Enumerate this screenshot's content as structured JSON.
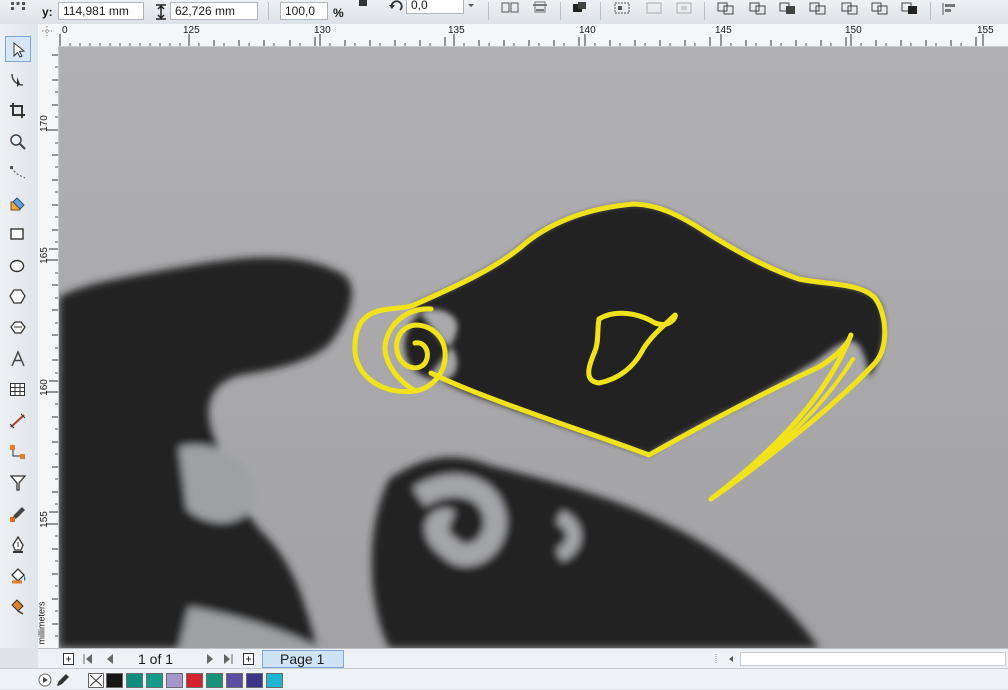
{
  "property_bar": {
    "y_label": "y:",
    "y_value": "114,981 mm",
    "height_value": "62,726 mm",
    "scale_value": "100,0",
    "scale_unit": "%",
    "rotation_value": "0,0"
  },
  "toolbox": {
    "tools": [
      "pick-tool-icon",
      "shape-tool-icon",
      "crop-tool-icon",
      "zoom-tool-icon",
      "freehand-tool-icon",
      "smart-fill-tool-icon",
      "rectangle-tool-icon",
      "ellipse-tool-icon",
      "polygon-tool-icon",
      "basic-shapes-tool-icon",
      "text-tool-icon",
      "table-tool-icon",
      "dimension-tool-icon",
      "connector-tool-icon",
      "blend-tool-icon",
      "eyedropper-tool-icon",
      "outline-tool-icon",
      "fill-tool-icon",
      "interactive-fill-tool-icon"
    ],
    "active_tool": "pick-tool-icon"
  },
  "rulers": {
    "horizontal_labels": [
      "0",
      "125",
      "130",
      "135",
      "140",
      "145",
      "150",
      "155"
    ],
    "vertical_labels": [
      "170",
      "165",
      "160",
      "155"
    ],
    "unit": "millimeters"
  },
  "page_navigator": {
    "page_count_text": "1 of 1",
    "page_tab": "Page 1"
  },
  "palette": {
    "colors": [
      "#151515",
      "#0f8c7e",
      "#159a8e",
      "#a796cc",
      "#d6222e",
      "#18937a",
      "#5b4da1",
      "#3b3688",
      "#1fb4d2"
    ]
  },
  "drawing": {
    "outline_color": "#f2e21a",
    "background_color": "#a9a9ab",
    "ink_color": "#222224"
  }
}
